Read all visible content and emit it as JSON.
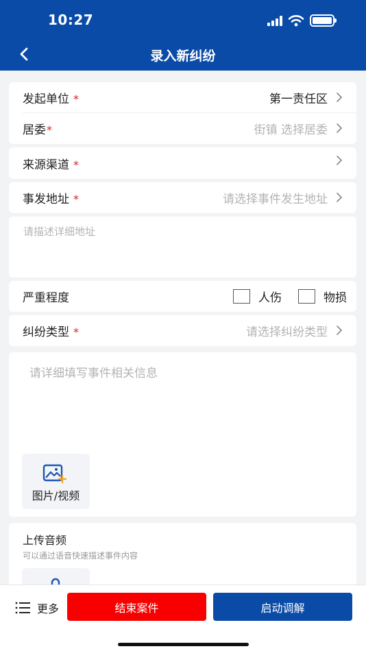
{
  "status_bar": {
    "time": "10:27"
  },
  "nav": {
    "title": "录入新纠纷"
  },
  "form": {
    "initiator": {
      "label": "发起单位",
      "required": "*",
      "value": "第一责任区"
    },
    "committee": {
      "label": "居委",
      "required": "*",
      "value": "街镇 选择居委"
    },
    "source": {
      "label": "来源渠道",
      "required": "*"
    },
    "address": {
      "label": "事发地址",
      "required": "*",
      "placeholder": "请选择事件发生地址"
    },
    "address_detail": {
      "placeholder": "请描述详细地址"
    },
    "severity": {
      "label": "严重程度",
      "options": [
        {
          "label": "人伤"
        },
        {
          "label": "物损"
        }
      ]
    },
    "dispute_type": {
      "label": "纠纷类型",
      "required": "*",
      "placeholder": "请选择纠纷类型"
    },
    "description": {
      "placeholder": "请详细填写事件相关信息"
    },
    "media": {
      "label": "图片/视频"
    },
    "audio": {
      "title": "上传音频",
      "hint": "可以通过语音快速描述事件内容"
    }
  },
  "bottom": {
    "more_label": "更多",
    "end_case_label": "结束案件",
    "start_mediation_label": "启动调解"
  },
  "colors": {
    "primary": "#0a4ba8",
    "danger": "#f90000",
    "required": "#d81e1e",
    "placeholder": "#b3b3b3",
    "background": "#f2f3f5"
  }
}
